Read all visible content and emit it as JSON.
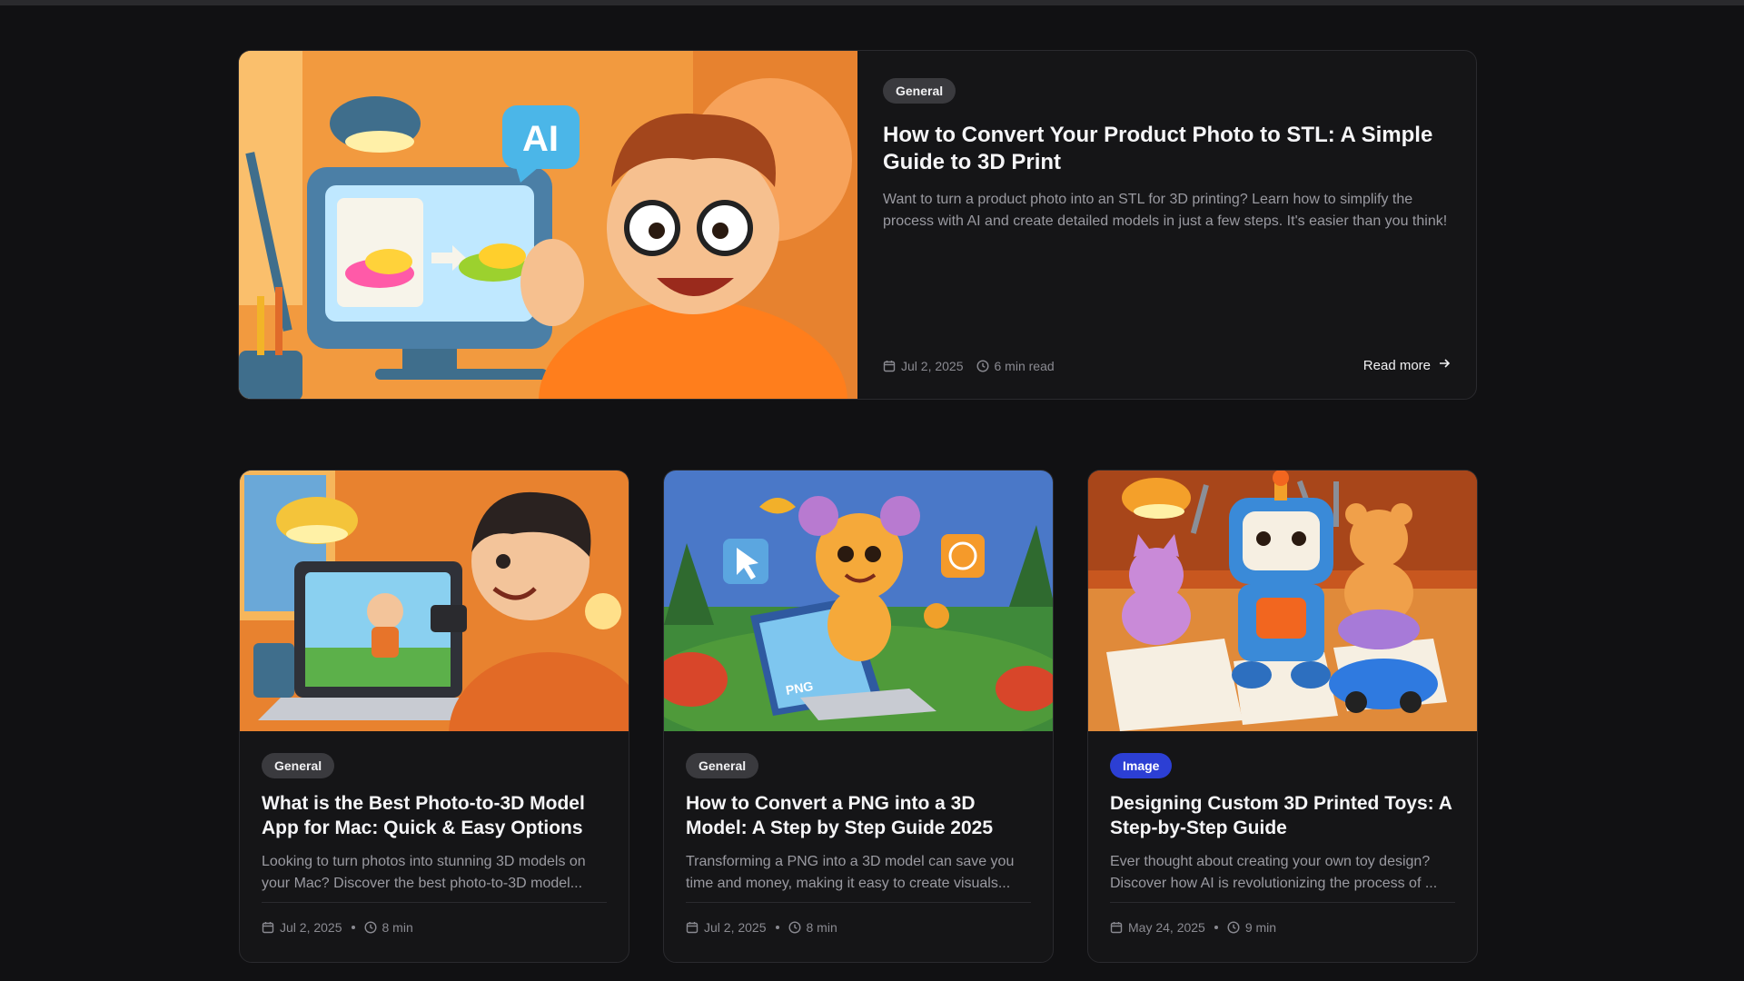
{
  "featured": {
    "category": "General",
    "title": "How to Convert Your Product Photo to STL: A Simple Guide to 3D Print",
    "description": "Want to turn a product photo into an STL for 3D printing? Learn how to simplify the process with AI and create detailed models in just a few steps. It's easier than you think!",
    "date": "Jul 2, 2025",
    "read_time": "6 min read",
    "read_more": "Read more",
    "image_text": "AI"
  },
  "posts": [
    {
      "category": "General",
      "category_style": "general",
      "title": "What is the Best Photo-to-3D Model App for Mac: Quick & Easy Options",
      "description": "Looking to turn photos into stunning 3D models on your Mac? Discover the best photo-to-3D model...",
      "date": "Jul 2, 2025",
      "read_time": "8 min"
    },
    {
      "category": "General",
      "category_style": "general",
      "title": "How to Convert a PNG into a 3D Model: A Step by Step Guide 2025",
      "description": "Transforming a PNG into a 3D model can save you time and money, making it easy to create visuals...",
      "date": "Jul 2, 2025",
      "read_time": "8 min",
      "image_text": "PNG"
    },
    {
      "category": "Image",
      "category_style": "image",
      "title": "Designing Custom 3D Printed Toys: A Step-by-Step Guide",
      "description": "Ever thought about creating your own toy design? Discover how AI is revolutionizing the process of ...",
      "date": "May 24, 2025",
      "read_time": "9 min"
    }
  ],
  "colors": {
    "background": "#111113",
    "card": "#151517",
    "badge_general": "#3a3a3e",
    "badge_image": "#2c3fd4"
  }
}
